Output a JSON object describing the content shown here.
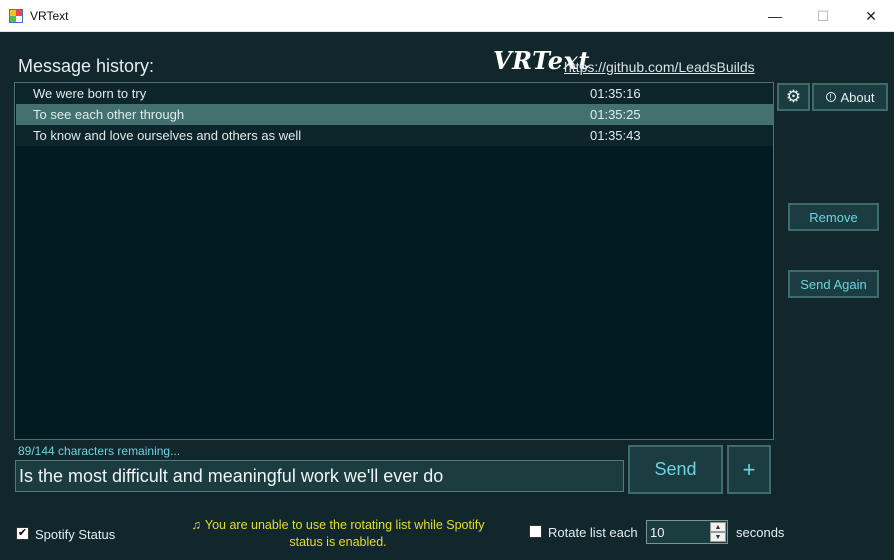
{
  "window": {
    "title": "VRText",
    "minimize_glyph": "—",
    "maximize_glyph": "☐",
    "close_glyph": "✕"
  },
  "header": {
    "history_label": "Message history:",
    "brand": "VRText",
    "link": "https://github.com/LeadsBuilds"
  },
  "history": [
    {
      "message": "We were born to try",
      "time": "01:35:16",
      "selected": false
    },
    {
      "message": "To see each other through",
      "time": "01:35:25",
      "selected": true
    },
    {
      "message": "To know and love ourselves and others as well",
      "time": "01:35:43",
      "selected": false
    }
  ],
  "side_buttons": {
    "settings_icon": "⚙",
    "about_icon": "!",
    "about_label": "About",
    "remove_label": "Remove",
    "send_again_label": "Send Again"
  },
  "input": {
    "chars_remaining": "89/144 characters remaining...",
    "value": "Is the most difficult and meaningful work we'll ever do",
    "send_label": "Send",
    "plus_label": "+"
  },
  "footer": {
    "spotify_checked": true,
    "spotify_label": "Spotify Status",
    "warning_icon": "♫",
    "warning_text": "You are unable to use the rotating list while Spotify status is enabled.",
    "rotate_checked": false,
    "rotate_label": "Rotate list each",
    "rotate_value": "10",
    "seconds_label": "seconds"
  },
  "colors": {
    "background": "#11272c",
    "list_background": "#021b22",
    "selected_row": "#43716e",
    "accent_text": "#6ed3e0",
    "warning_text": "#e6dc2c"
  }
}
